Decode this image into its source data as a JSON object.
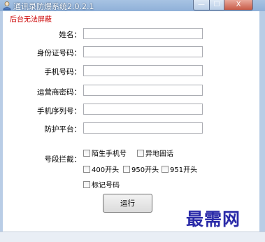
{
  "window": {
    "title": "通讯录防爆系统2.0.2.1",
    "min_glyph": "—",
    "max_glyph": "☐",
    "close_glyph": "X"
  },
  "notice": "后台无法屏蔽",
  "form": {
    "name_label": "姓名：",
    "id_label": "身份证号码：",
    "phone_label": "手机号码：",
    "carrier_pwd_label": "运营商密码：",
    "serial_label": "手机序列号：",
    "platform_label": "防护平台：",
    "name_value": "",
    "id_value": "",
    "phone_value": "",
    "carrier_pwd_value": "",
    "serial_value": "",
    "platform_value": ""
  },
  "block": {
    "label": "号段拦截：",
    "options": [
      "陌生手机号",
      "异地固话",
      "400开头",
      "950开头",
      "951开头",
      "标记号码"
    ]
  },
  "run_button": "运行",
  "watermark": "最需网"
}
